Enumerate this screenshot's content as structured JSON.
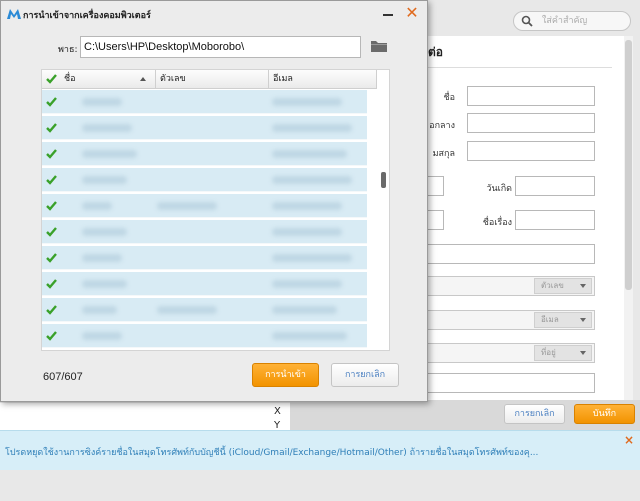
{
  "background": {
    "search_placeholder": "ใส่คำสำคัญ",
    "panel_title": "ต่อ",
    "labels": {
      "first_name": "ชื่อ",
      "middle_name": "อกลาง",
      "last_name": "มสกุล",
      "birthday": "วันเกิด",
      "subject": "ชื่อเรื่อง"
    },
    "selects": [
      "ตัวเลข",
      "อีเมล",
      "ที่อยู่"
    ],
    "cancel_label": "การยกเลิก",
    "save_label": "บันทึก",
    "side_letters": [
      "X",
      "Y"
    ]
  },
  "notice": {
    "text": "โปรดหยุดใช้งานการซิงค์รายชื่อในสมุดโทรศัพท์กับบัญชีนี้ (iCloud/Gmail/Exchange/Hotmail/Other) ถ้ารายชื่อในสมุดโทรศัพท์ของคุ...",
    "close_glyph": "×"
  },
  "dialog": {
    "title": "การนำเข้าจากเครื่องคอมพิวเตอร์",
    "close_glyph": "✕",
    "path_label": "พาธ:",
    "path_value": "C:\\Users\\HP\\Desktop\\Moborobo\\",
    "columns": [
      "ชื่อ",
      "ตัวเลข",
      "อีเมล"
    ],
    "row_count": 10,
    "count_text": "607/607",
    "import_label": "การนำเข้า",
    "cancel_label": "การยกเลิก"
  },
  "colors": {
    "accent_orange": "#f29300",
    "link_blue": "#4a7fc0",
    "check_green": "#3aa12a",
    "row_blue": "#d8ebf4"
  }
}
